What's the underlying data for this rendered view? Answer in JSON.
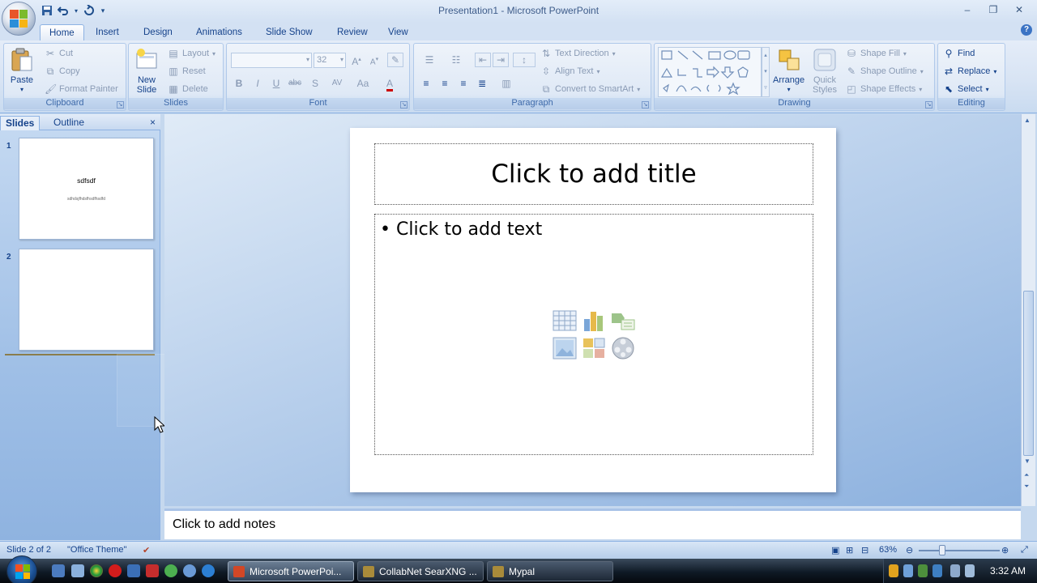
{
  "window": {
    "title": "Presentation1 - Microsoft PowerPoint"
  },
  "quick_access": {
    "save_icon": "save-icon",
    "undo_icon": "undo-icon",
    "redo_icon": "redo-icon"
  },
  "ribbon_tabs": [
    "Home",
    "Insert",
    "Design",
    "Animations",
    "Slide Show",
    "Review",
    "View"
  ],
  "ribbon": {
    "clipboard": {
      "label": "Clipboard",
      "paste": "Paste",
      "cut": "Cut",
      "copy": "Copy",
      "format_painter": "Format Painter"
    },
    "slides": {
      "label": "Slides",
      "new_slide_1": "New",
      "new_slide_2": "Slide",
      "layout": "Layout",
      "reset": "Reset",
      "delete": "Delete"
    },
    "font": {
      "label": "Font",
      "size": "32",
      "bold": "B",
      "italic": "I",
      "underline": "U",
      "strike": "abc",
      "shadow": "S",
      "spacing": "AV",
      "case": "Aa"
    },
    "paragraph": {
      "label": "Paragraph",
      "text_direction": "Text Direction",
      "align_text": "Align Text",
      "convert_smartart": "Convert to SmartArt"
    },
    "drawing": {
      "label": "Drawing",
      "arrange": "Arrange",
      "quick_styles_1": "Quick",
      "quick_styles_2": "Styles",
      "shape_fill": "Shape Fill",
      "shape_outline": "Shape Outline",
      "shape_effects": "Shape Effects"
    },
    "editing": {
      "label": "Editing",
      "find": "Find",
      "replace": "Replace",
      "select": "Select"
    }
  },
  "slides_pane": {
    "tab_slides": "Slides",
    "tab_outline": "Outline",
    "close": "×",
    "slides": [
      {
        "number": "1",
        "title": "sdfsdf",
        "subtitle": "sdhdsjfhdsfhsdfhsdfd"
      },
      {
        "number": "2",
        "title": "",
        "subtitle": ""
      }
    ]
  },
  "slide": {
    "title_placeholder": "Click to add title",
    "body_placeholder": "Click to add text",
    "bullet": "•"
  },
  "notes": {
    "placeholder": "Click to add notes"
  },
  "status_bar": {
    "slide_info": "Slide 2 of 2",
    "theme": "\"Office Theme\"",
    "zoom": "63%"
  },
  "taskbar": {
    "tasks": [
      "Microsoft PowerPoi...",
      "CollabNet SearXNG ...",
      "Mypal"
    ],
    "clock": "3:32 AM"
  }
}
